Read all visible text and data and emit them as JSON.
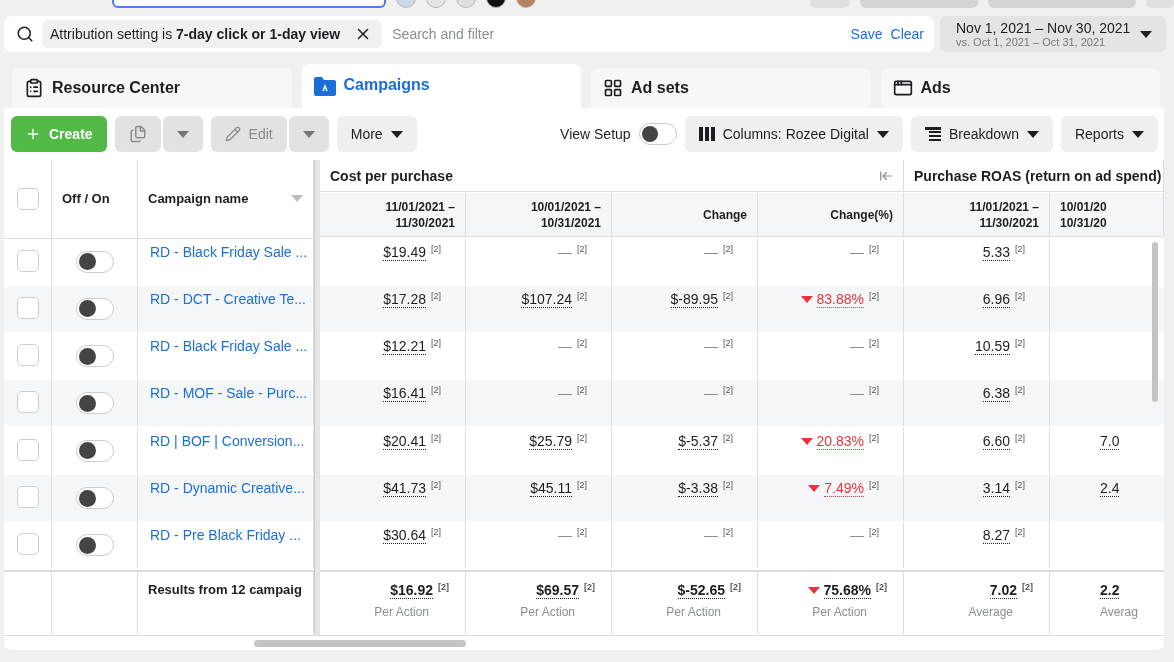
{
  "filter_bar": {
    "chip": "Attribution setting is **7-day click or 1-day view**",
    "placeholder": "Search and filter",
    "save": "Save",
    "clear": "Clear"
  },
  "date_range": {
    "primary": "Nov 1, 2021 – Nov 30, 2021",
    "comparison": "vs. Oct 1, 2021 – Oct 31, 2021"
  },
  "tabs": [
    {
      "label": "Resource Center",
      "kind": "resources",
      "selected": false
    },
    {
      "label": "Campaigns",
      "kind": "campaigns",
      "selected": true
    },
    {
      "label": "Ad sets",
      "kind": "adsets",
      "selected": false
    },
    {
      "label": "Ads",
      "kind": "ads",
      "selected": false
    }
  ],
  "toolbar": {
    "create": "Create",
    "edit": "Edit",
    "more": "More",
    "view_setup": {
      "label": "View Setup",
      "on": false
    },
    "columns": "Columns: Rozee Digital",
    "breakdown": "Breakdown",
    "reports": "Reports"
  },
  "table": {
    "select_all": {
      "checked": false
    },
    "off_on": "Off / On",
    "name_header": "Campaign name",
    "groups": [
      {
        "title": "Cost per purchase",
        "subcolumns": [
          [
            "11/01/2021 –",
            "11/30/2021"
          ],
          [
            "10/01/2021 –",
            "10/31/2021"
          ],
          [
            "Change"
          ],
          [
            "Change(%)"
          ]
        ]
      },
      {
        "title": "Purchase ROAS (return on ad spend)",
        "subcolumns": [
          [
            "11/01/2021 –",
            "11/30/2021"
          ],
          [
            "10/01/20",
            "10/31/20"
          ]
        ]
      }
    ],
    "rows": [
      {
        "checked": false,
        "on": false,
        "name": "RD - Black Friday Sale ...",
        "cells": [
          {
            "kind": "metric",
            "value": "$19.49",
            "note": "[2]"
          },
          {
            "kind": "blank",
            "value": "—",
            "note": "[2]"
          },
          {
            "kind": "blank",
            "value": "—",
            "note": "[2]"
          },
          {
            "kind": "blank",
            "value": "—",
            "note": "[2]"
          },
          {
            "kind": "metric",
            "value": "5.33",
            "note": "[2]"
          },
          {
            "kind": "none"
          }
        ]
      },
      {
        "checked": false,
        "on": false,
        "name": "RD - DCT - Creative Te...",
        "cells": [
          {
            "kind": "metric",
            "value": "$17.28",
            "note": "[2]"
          },
          {
            "kind": "metric",
            "value": "$107.24",
            "note": "[2]"
          },
          {
            "kind": "metric",
            "value": "$-89.95",
            "note": "[2]"
          },
          {
            "kind": "metric",
            "value": "83.88%",
            "note": "[2]",
            "decreased": true
          },
          {
            "kind": "metric",
            "value": "6.96",
            "note": "[2]"
          },
          {
            "kind": "none"
          }
        ]
      },
      {
        "checked": false,
        "on": false,
        "name": "RD - Black Friday Sale ...",
        "cells": [
          {
            "kind": "metric",
            "value": "$12.21",
            "note": "[2]"
          },
          {
            "kind": "blank",
            "value": "—",
            "note": "[2]"
          },
          {
            "kind": "blank",
            "value": "—",
            "note": "[2]"
          },
          {
            "kind": "blank",
            "value": "—",
            "note": "[2]"
          },
          {
            "kind": "metric",
            "value": "10.59",
            "note": "[2]"
          },
          {
            "kind": "none"
          }
        ]
      },
      {
        "checked": false,
        "on": false,
        "name": "RD - MOF - Sale - Purc...",
        "cells": [
          {
            "kind": "metric",
            "value": "$16.41",
            "note": "[2]"
          },
          {
            "kind": "blank",
            "value": "—",
            "note": "[2]"
          },
          {
            "kind": "blank",
            "value": "—",
            "note": "[2]"
          },
          {
            "kind": "blank",
            "value": "—",
            "note": "[2]"
          },
          {
            "kind": "metric",
            "value": "6.38",
            "note": "[2]"
          },
          {
            "kind": "none"
          }
        ]
      },
      {
        "checked": false,
        "on": false,
        "name": "RD | BOF | Conversion...",
        "cells": [
          {
            "kind": "metric",
            "value": "$20.41",
            "note": "[2]"
          },
          {
            "kind": "metric",
            "value": "$25.79",
            "note": "[2]"
          },
          {
            "kind": "metric",
            "value": "$-5.37",
            "note": "[2]"
          },
          {
            "kind": "metric",
            "value": "20.83%",
            "note": "[2]",
            "decreased": true
          },
          {
            "kind": "metric",
            "value": "6.60",
            "note": "[2]"
          },
          {
            "kind": "metric",
            "value": "7.0"
          }
        ]
      },
      {
        "checked": false,
        "on": false,
        "name": "RD - Dynamic Creative...",
        "cells": [
          {
            "kind": "metric",
            "value": "$41.73",
            "note": "[2]"
          },
          {
            "kind": "metric",
            "value": "$45.11",
            "note": "[2]"
          },
          {
            "kind": "metric",
            "value": "$-3.38",
            "note": "[2]"
          },
          {
            "kind": "metric",
            "value": "7.49%",
            "note": "[2]",
            "decreased": true
          },
          {
            "kind": "metric",
            "value": "3.14",
            "note": "[2]"
          },
          {
            "kind": "metric",
            "value": "2.4"
          }
        ]
      },
      {
        "checked": false,
        "on": false,
        "name": "RD - Pre Black Friday ...",
        "cells": [
          {
            "kind": "metric",
            "value": "$30.64",
            "note": "[2]"
          },
          {
            "kind": "blank",
            "value": "—",
            "note": "[2]"
          },
          {
            "kind": "blank",
            "value": "—",
            "note": "[2]"
          },
          {
            "kind": "blank",
            "value": "—",
            "note": "[2]"
          },
          {
            "kind": "metric",
            "value": "8.27",
            "note": "[2]"
          },
          {
            "kind": "none"
          }
        ]
      }
    ],
    "footer": {
      "label": "Results from 12 campaig",
      "totals": [
        {
          "value": "$16.92",
          "note": "[2]",
          "sub": "Per Action"
        },
        {
          "value": "$69.57",
          "note": "[2]",
          "sub": "Per Action"
        },
        {
          "value": "$-52.65",
          "note": "[2]",
          "sub": "Per Action"
        },
        {
          "value": "75.68%",
          "note": "[2]",
          "sub": "Per Action",
          "decreased": true
        },
        {
          "value": "7.02",
          "note": "[2]",
          "sub": "Average"
        },
        {
          "value": "2.2",
          "sub": "Averag"
        }
      ]
    }
  }
}
